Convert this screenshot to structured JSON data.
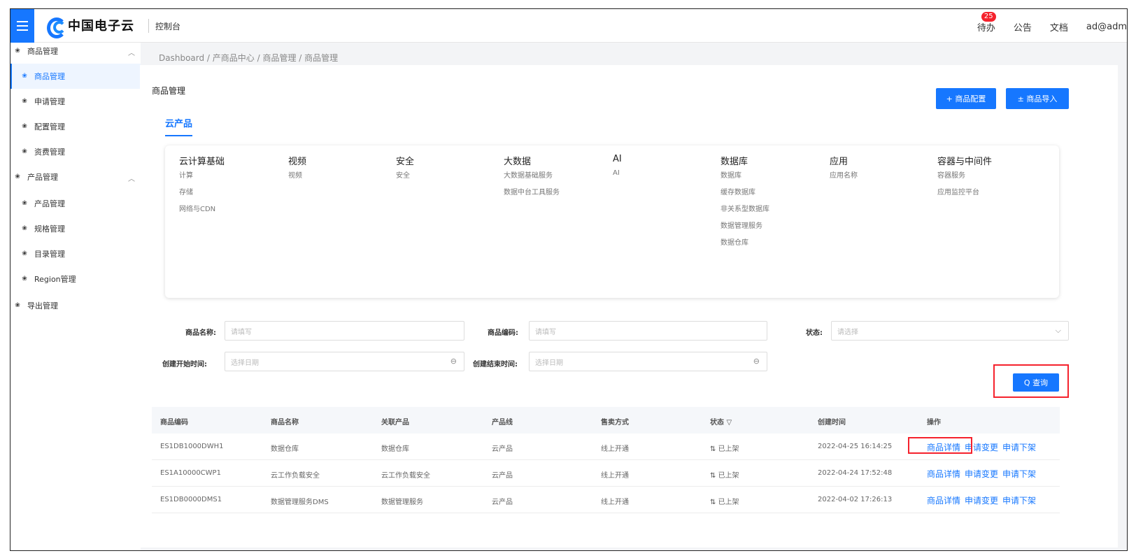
{
  "header": {
    "logo_text": "中国电子云",
    "console": "控制台",
    "todo_label": "待办",
    "todo_badge": "25",
    "notice": "公告",
    "docs": "文档",
    "user": "ad@adm"
  },
  "sidebar": {
    "items": [
      {
        "label": "商品管理",
        "level": 1,
        "expanded": true
      },
      {
        "label": "商品管理",
        "level": 2,
        "active": true
      },
      {
        "label": "申请管理",
        "level": 2
      },
      {
        "label": "配置管理",
        "level": 2
      },
      {
        "label": "资费管理",
        "level": 2
      },
      {
        "label": "产品管理",
        "level": 1,
        "expanded": true
      },
      {
        "label": "产品管理",
        "level": 2
      },
      {
        "label": "规格管理",
        "level": 2
      },
      {
        "label": "目录管理",
        "level": 2
      },
      {
        "label": "Region管理",
        "level": 2
      },
      {
        "label": "导出管理",
        "level": 1
      }
    ]
  },
  "breadcrumb": "Dashboard / 产商品中心 / 商品管理 / 商品管理",
  "page": {
    "title": "商品管理",
    "btn_config": "+ 商品配置",
    "btn_import": "± 商品导入",
    "tab": "云产品"
  },
  "categories": [
    {
      "head": "云计算基础",
      "items": [
        "计算",
        "存储",
        "网络与CDN"
      ]
    },
    {
      "head": "视频",
      "items": [
        "视频"
      ]
    },
    {
      "head": "安全",
      "items": [
        "安全"
      ]
    },
    {
      "head": "大数据",
      "items": [
        "大数据基础服务",
        "数据中台工具服务"
      ]
    },
    {
      "head": "AI",
      "items": [
        "AI"
      ]
    },
    {
      "head": "数据库",
      "items": [
        "数据库",
        "缓存数据库",
        "非关系型数据库",
        "数据管理服务",
        "数据仓库"
      ]
    },
    {
      "head": "应用",
      "items": [
        "应用名称"
      ]
    },
    {
      "head": "容器与中间件",
      "items": [
        "容器服务",
        "应用监控平台"
      ]
    }
  ],
  "filters": {
    "name_label": "商品名称:",
    "name_placeholder": "请填写",
    "code_label": "商品编码:",
    "code_placeholder": "请填写",
    "status_label": "状态:",
    "status_placeholder": "请选择",
    "start_label": "创建开始时间:",
    "start_placeholder": "选择日期",
    "end_label": "创建结束时间:",
    "end_placeholder": "选择日期",
    "query_btn": "Q 查询"
  },
  "table": {
    "headers": [
      "商品编码",
      "商品名称",
      "关联产品",
      "产品线",
      "售卖方式",
      "状态 ▽",
      "创建时间",
      "操作"
    ],
    "rows": [
      {
        "code": "ES1DB1000DWH1",
        "name": "数据仓库",
        "product": "数据仓库",
        "line": "云产品",
        "sale": "线上开通",
        "status": "已上架",
        "time": "2022-04-25 16:14:25"
      },
      {
        "code": "ES1A10000CWP1",
        "name": "云工作负载安全",
        "product": "云工作负载安全",
        "line": "云产品",
        "sale": "线上开通",
        "status": "已上架",
        "time": "2022-04-24 17:52:48"
      },
      {
        "code": "ES1DB0000DMS1",
        "name": "数据管理服务DMS",
        "product": "数据管理服务",
        "line": "云产品",
        "sale": "线上开通",
        "status": "已上架",
        "time": "2022-04-02 17:26:13"
      }
    ],
    "actions": [
      "商品详情",
      "申请变更",
      "申请下架"
    ]
  }
}
